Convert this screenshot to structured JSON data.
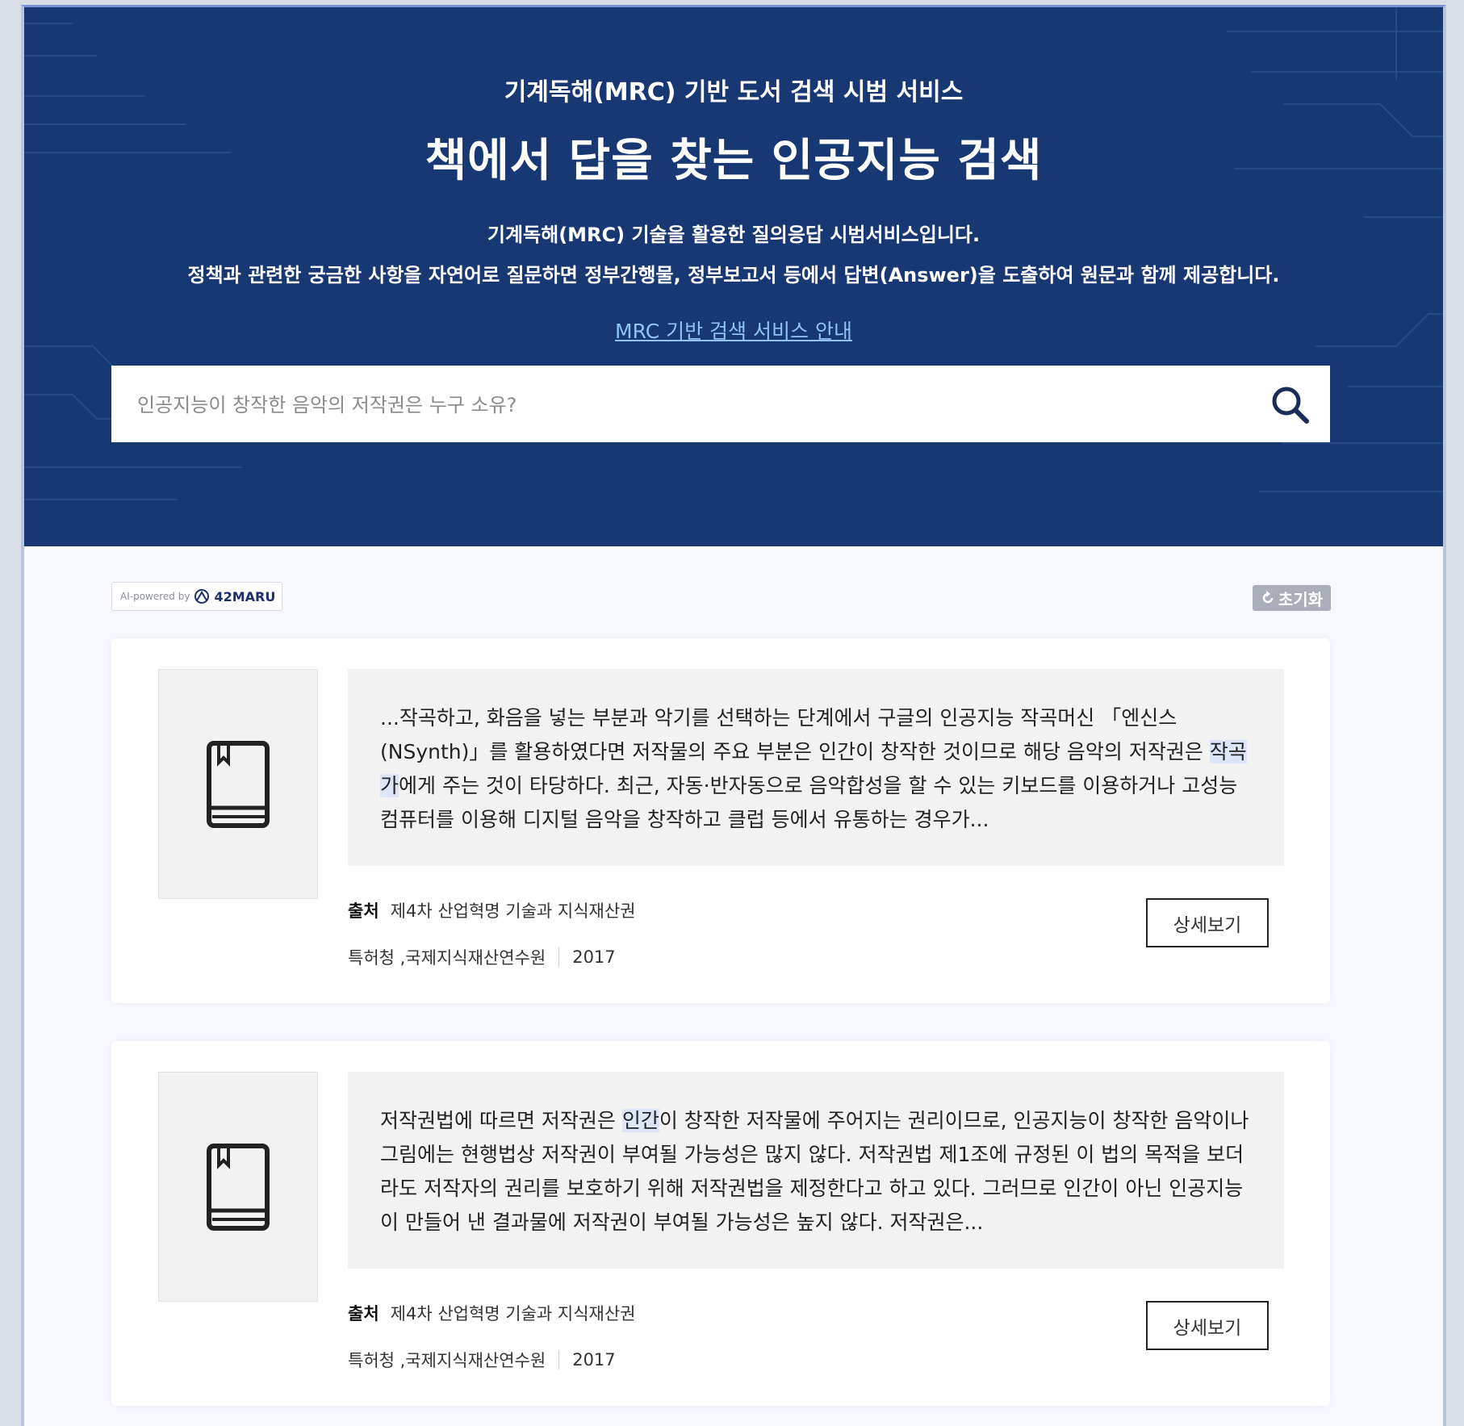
{
  "hero": {
    "subtitle": "기계독해(MRC) 기반 도서 검색 시범 서비스",
    "title": "책에서 답을 찾는 인공지능 검색",
    "description_line1": "기계독해(MRC) 기술을 활용한 질의응답 시범서비스입니다.",
    "description_line2": "정책과 관련한 궁금한 사항을 자연어로 질문하면 정부간행물, 정부보고서 등에서 답변(Answer)을 도출하여 원문과 함께 제공합니다.",
    "guide_link": "MRC 기반 검색 서비스 안내"
  },
  "search": {
    "placeholder": "인공지능이 창작한 음악의 저작권은 누구 소유?",
    "icon": "search-icon"
  },
  "powered_by": {
    "prefix": "AI-powered by",
    "brand": "42MARU"
  },
  "reset": {
    "label": "초기화",
    "icon": "refresh-icon"
  },
  "results": [
    {
      "excerpt_before": "...작곡하고, 화음을 넣는 부분과 악기를 선택하는 단계에서 구글의 인공지능 작곡머신 「엔신스(NSynth)」를 활용하였다면 저작물의 주요 부분은 인간이 창작한 것이므로 해당 음악의 저작권은 ",
      "excerpt_highlight": "작곡가",
      "excerpt_after": "에게 주는 것이 타당하다. 최근, 자동·반자동으로 음악합성을 할 수 있는 키보드를 이용하거나 고성능 컴퓨터를 이용해 디지털 음악을 창작하고 클럽 등에서 유통하는 경우가...",
      "source_label": "출처",
      "source_title": "제4차 산업혁명 기술과 지식재산권",
      "publisher": "특허청 ,국제지식재산연수원",
      "year": "2017",
      "detail_label": "상세보기",
      "thumb_icon": "book-icon"
    },
    {
      "excerpt_before": "저작권법에 따르면 저작권은 ",
      "excerpt_highlight": "인간",
      "excerpt_after": "이 창작한 저작물에 주어지는 권리이므로, 인공지능이 창작한 음악이나 그림에는 현행법상 저작권이 부여될 가능성은 많지 않다. 저작권법 제1조에 규정된 이 법의 목적을 보더라도 저작자의 권리를 보호하기 위해 저작권법을 제정한다고 하고 있다. 그러므로 인간이 아닌 인공지능이 만들어 낸 결과물에 저작권이 부여될 가능성은 높지 않다. 저작권은...",
      "source_label": "출처",
      "source_title": "제4차 산업혁명 기술과 지식재산권",
      "publisher": "특허청 ,국제지식재산연수원",
      "year": "2017",
      "detail_label": "상세보기",
      "thumb_icon": "book-icon"
    }
  ],
  "colors": {
    "hero_background": "#173873",
    "link": "#8ec3f2",
    "highlight": "#dce6f8",
    "reset_button": "#a9aeb8"
  }
}
